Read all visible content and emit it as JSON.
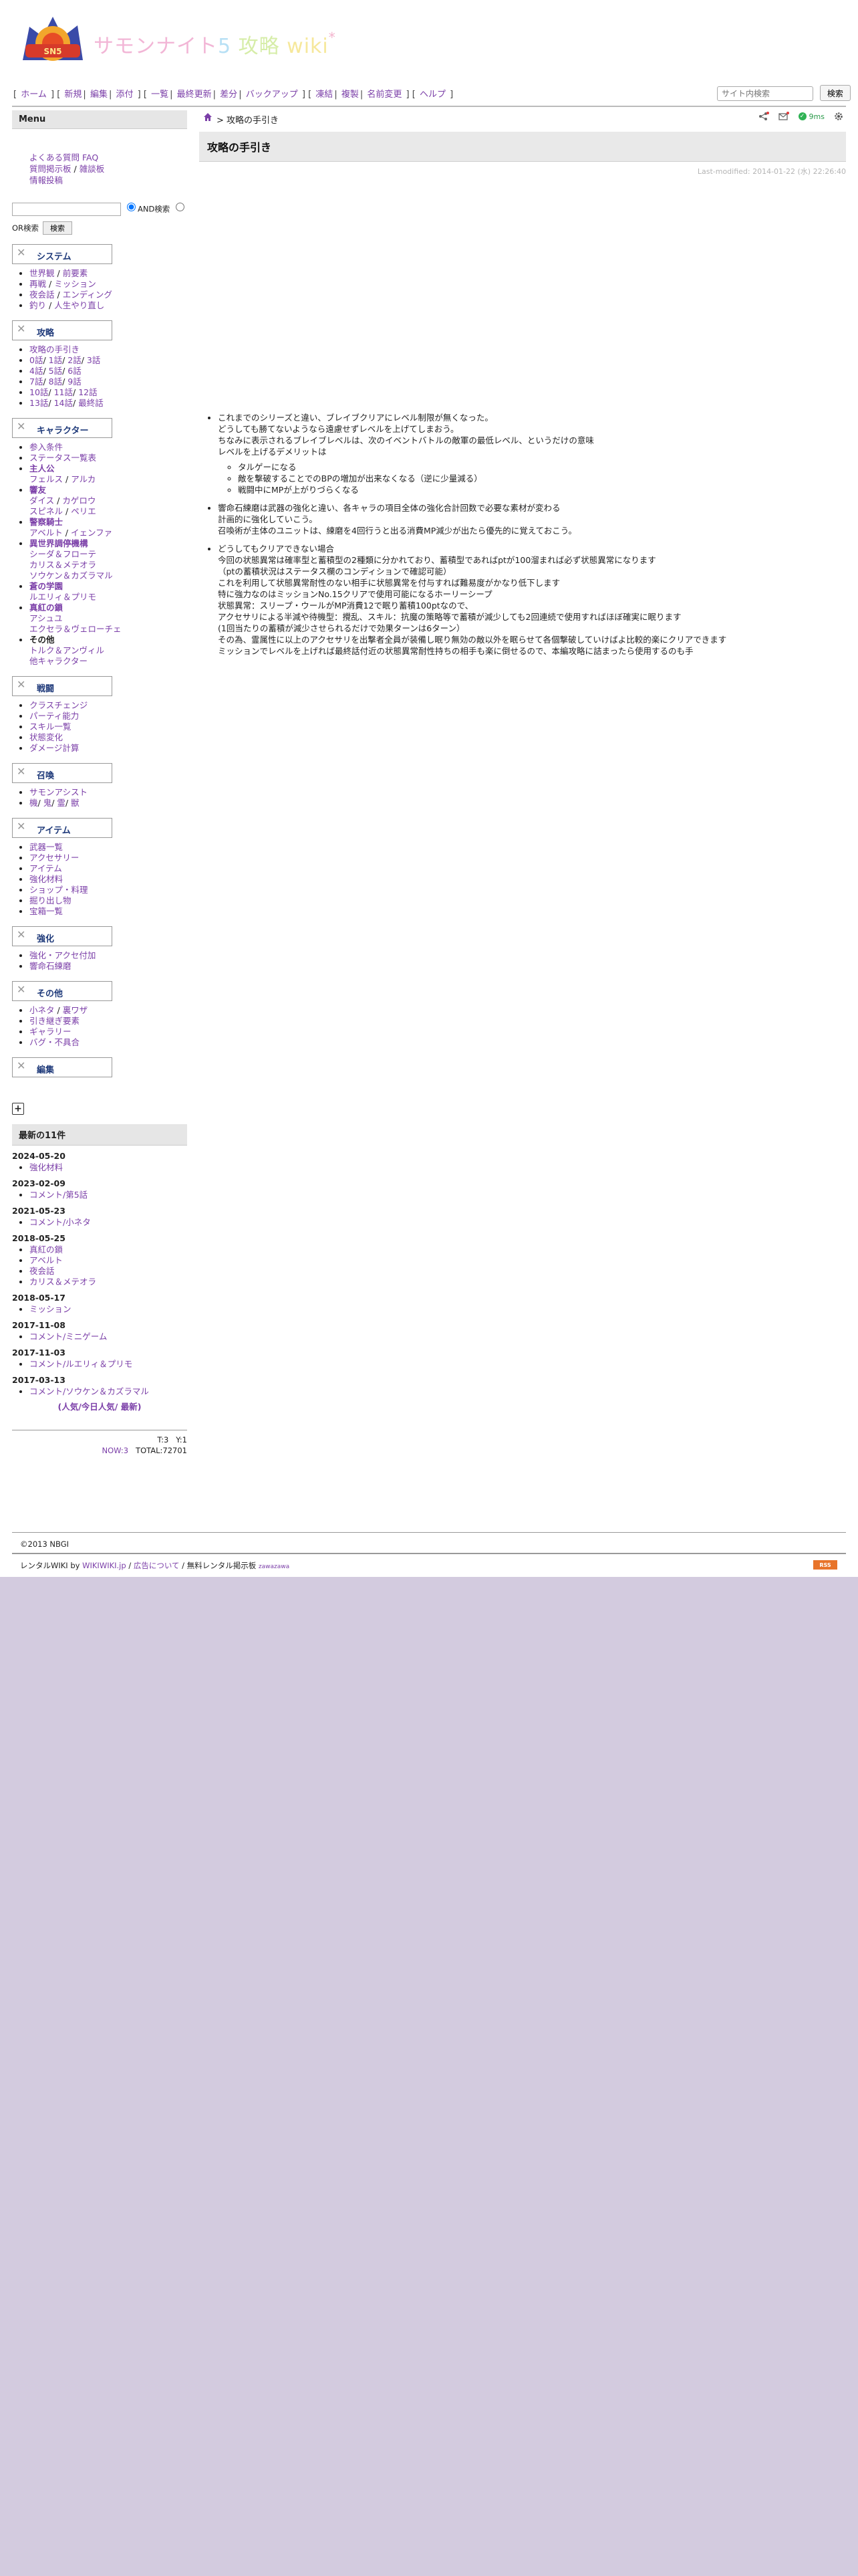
{
  "header": {
    "title_parts": [
      "サモンナイト",
      "5",
      " 攻略",
      " wiki",
      "*"
    ],
    "logo_alt": "サモンナイト5"
  },
  "nav": {
    "items": [
      "ホーム",
      "新規",
      "編集",
      "添付",
      "一覧",
      "最終更新",
      "差分",
      "バックアップ",
      "凍結",
      "複製",
      "名前変更",
      "ヘルプ"
    ]
  },
  "search_top": {
    "placeholder": "サイト内検索",
    "button": "検索"
  },
  "sidebar": {
    "menu_title": "Menu",
    "faq": [
      {
        "a": "よくある質問 FAQ"
      },
      {
        "a": "質問掲示板",
        "sep": " / ",
        "b": "雑談板"
      },
      {
        "a": "情報投稿"
      }
    ],
    "search": {
      "and_label": "AND検索",
      "or_label": "OR検索",
      "button": "検索"
    },
    "sections": [
      {
        "title": "システム",
        "items": [
          {
            "parts": [
              "世界観",
              " / ",
              "前要素"
            ]
          },
          {
            "parts": [
              "再戦",
              " / ",
              "ミッション"
            ]
          },
          {
            "parts": [
              "夜会話",
              " / ",
              "エンディング"
            ]
          },
          {
            "parts": [
              "釣り",
              " / ",
              "人生やり直し"
            ]
          }
        ]
      },
      {
        "title": "攻略",
        "items": [
          {
            "parts": [
              "攻略の手引き"
            ]
          },
          {
            "parts": [
              "0話",
              "/ ",
              "1話",
              "/ ",
              "2話",
              "/ ",
              "3話"
            ]
          },
          {
            "parts": [
              "4話",
              "/ ",
              "5話",
              "/ ",
              "6話"
            ]
          },
          {
            "parts": [
              "7話",
              "/ ",
              "8話",
              "/ ",
              "9話"
            ]
          },
          {
            "parts": [
              "10話",
              "/ ",
              "11話",
              "/ ",
              "12話"
            ]
          },
          {
            "parts": [
              "13話",
              "/ ",
              "14話",
              "/ ",
              "最終話"
            ]
          }
        ]
      },
      {
        "title": "キャラクター",
        "items": [
          {
            "parts": [
              "参入条件"
            ]
          },
          {
            "parts": [
              "ステータス一覧表"
            ]
          },
          {
            "parts": [
              "主人公"
            ],
            "bold": true
          },
          {
            "parts": [
              "フェルス",
              " / ",
              "アルカ"
            ],
            "sub": true
          },
          {
            "parts": [
              "響友"
            ],
            "bold": true
          },
          {
            "parts": [
              "ダイス",
              " / ",
              "カゲロウ"
            ],
            "sub": true
          },
          {
            "parts": [
              "スピネル",
              " / ",
              "ペリエ"
            ],
            "sub": true
          },
          {
            "parts": [
              "警察騎士"
            ],
            "bold": true
          },
          {
            "parts": [
              "アベルト",
              " / ",
              "イェンファ"
            ],
            "sub": true
          },
          {
            "parts": [
              "異世界調停機構"
            ],
            "bold": true
          },
          {
            "parts": [
              "シーダ＆フローテ"
            ],
            "sub": true
          },
          {
            "parts": [
              "カリス＆メテオラ"
            ],
            "sub": true
          },
          {
            "parts": [
              "ソウケン＆カズラマル"
            ],
            "sub": true
          },
          {
            "parts": [
              "蒼の学園"
            ],
            "bold": true
          },
          {
            "parts": [
              "ルエリィ＆プリモ"
            ],
            "sub": true
          },
          {
            "parts": [
              "真紅の鎖"
            ],
            "bold": true
          },
          {
            "parts": [
              "アシュユ"
            ],
            "sub": true
          },
          {
            "parts": [
              "エクセラ＆ヴェローチェ"
            ],
            "sub": true
          },
          {
            "parts": [
              "その他"
            ],
            "bold": true,
            "plain": true
          },
          {
            "parts": [
              "トルク＆アンヴィル"
            ],
            "sub": true
          },
          {
            "parts": [
              "他キャラクター"
            ],
            "sub": true
          }
        ]
      },
      {
        "title": "戦闘",
        "items": [
          {
            "parts": [
              "クラスチェンジ"
            ]
          },
          {
            "parts": [
              "パーティ能力"
            ]
          },
          {
            "parts": [
              "スキル一覧"
            ]
          },
          {
            "parts": [
              "状態変化"
            ]
          },
          {
            "parts": [
              "ダメージ計算"
            ]
          }
        ]
      },
      {
        "title": "召喚",
        "items": [
          {
            "parts": [
              "サモンアシスト"
            ]
          },
          {
            "parts": [
              "機",
              "/ ",
              "鬼",
              "/ ",
              "霊",
              "/ ",
              "獣"
            ]
          }
        ]
      },
      {
        "title": "アイテム",
        "items": [
          {
            "parts": [
              "武器一覧"
            ]
          },
          {
            "parts": [
              "アクセサリー"
            ]
          },
          {
            "parts": [
              "アイテム"
            ]
          },
          {
            "parts": [
              "強化材料"
            ]
          },
          {
            "parts": [
              "ショップ・料理"
            ]
          },
          {
            "parts": [
              "掘り出し物"
            ]
          },
          {
            "parts": [
              "宝箱一覧"
            ]
          }
        ]
      },
      {
        "title": "強化",
        "items": [
          {
            "parts": [
              "強化・アクセ付加"
            ]
          },
          {
            "parts": [
              "響命石練磨"
            ]
          }
        ]
      },
      {
        "title": "その他",
        "items": [
          {
            "parts": [
              "小ネタ",
              " / ",
              "裏ワザ"
            ]
          },
          {
            "parts": [
              "引き継ぎ要素"
            ]
          },
          {
            "parts": [
              "ギャラリー"
            ]
          },
          {
            "parts": [
              "バグ・不具合"
            ]
          }
        ]
      },
      {
        "title": "編集",
        "items": []
      }
    ],
    "recent": {
      "title": "最新の11件",
      "groups": [
        {
          "date": "2024-05-20",
          "items": [
            "強化材料"
          ]
        },
        {
          "date": "2023-02-09",
          "items": [
            "コメント/第5話"
          ]
        },
        {
          "date": "2021-05-23",
          "items": [
            "コメント/小ネタ"
          ]
        },
        {
          "date": "2018-05-25",
          "items": [
            "真紅の鎖",
            "アベルト",
            "夜会話",
            "カリス＆メテオラ"
          ]
        },
        {
          "date": "2018-05-17",
          "items": [
            "ミッション"
          ]
        },
        {
          "date": "2017-11-08",
          "items": [
            "コメント/ミニゲーム"
          ]
        },
        {
          "date": "2017-11-03",
          "items": [
            "コメント/ルエリィ＆プリモ"
          ]
        },
        {
          "date": "2017-03-13",
          "items": [
            "コメント/ソウケン＆カズラマル"
          ]
        }
      ],
      "ranking": "(人気/今日人気/ 最新)"
    },
    "counter": {
      "today": "T:3",
      "yesterday": "Y:1",
      "now": "NOW:3",
      "total": "TOTAL:72701"
    }
  },
  "main": {
    "breadcrumb": "攻略の手引き",
    "breadcrumb_sep": ">",
    "response_time": "9ms",
    "page_title": "攻略の手引き",
    "last_modified": "Last-modified: 2014-01-22 (水) 22:26:40",
    "content": [
      {
        "lines": [
          "これまでのシリーズと違い、ブレイブクリアにレベル制限が無くなった。",
          "どうしても勝てないようなら遠慮せずレベルを上げてしまおう。",
          "ちなみに表示されるブレイブレベルは、次のイベントバトルの敵軍の最低レベル、というだけの意味",
          "レベルを上げるデメリットは"
        ],
        "sub": [
          "タルゲーになる",
          "敵を撃破することでのBPの増加が出来なくなる（逆に少量減る）",
          "戦闘中にMPが上がりづらくなる"
        ]
      },
      {
        "lines": [
          "響命石練磨は武器の強化と違い、各キャラの項目全体の強化合計回数で必要な素材が変わる",
          "計画的に強化していこう。",
          "召喚術が主体のユニットは、練磨を4回行うと出る消費MP減少が出たら優先的に覚えておこう。"
        ]
      },
      {
        "lines": [
          "どうしてもクリアできない場合",
          "今回の状態異常は確率型と蓄積型の2種類に分かれており、蓄積型であればptが100溜まれば必ず状態異常になります",
          "（ptの蓄積状況はステータス欄のコンディションで確認可能）",
          "これを利用して状態異常耐性のない相手に状態異常を付与すれば難易度がかなり低下します",
          "特に強力なのはミッションNo.15クリアで使用可能になるホーリーシープ",
          "状態異常：スリープ・ウールがMP消費12で眠り蓄積100ptなので、",
          "アクセサリによる半減や待機型：攪乱、スキル：抗魔の策略等で蓄積が減少しても2回連続で使用すればほぼ確実に眠ります",
          "(1回当たりの蓄積が減少させられるだけで効果ターンは6ターン）",
          "その為、霊属性に以上のアクセサリを出撃者全員が装備し眠り無効の敵以外を眠らせて各個撃破していけばよ比較的楽にクリアできます",
          "ミッションでレベルを上げれば最終話付近の状態異常耐性持ちの相手も楽に倒せるので、本編攻略に詰まったら使用するのも手"
        ]
      }
    ]
  },
  "footer": {
    "copyright": "©2013 NBGI",
    "rental": "レンタルWIKI by ",
    "wikiwiki": "WIKIWIKI.jp",
    "ad": "広告について",
    "free": "無料レンタル掲示板",
    "zawazawa": "zawazawa",
    "rss": "RSS"
  },
  "colors": {
    "link": "#7b3fa8",
    "section_title": "#1f3a7a",
    "background": "#d3cbdf",
    "status_ok": "#2fb254"
  },
  "icons": [
    "home-icon",
    "share-icon",
    "mail-icon",
    "status-ok-icon",
    "gear-icon",
    "section-x-icon",
    "add-icon"
  ]
}
